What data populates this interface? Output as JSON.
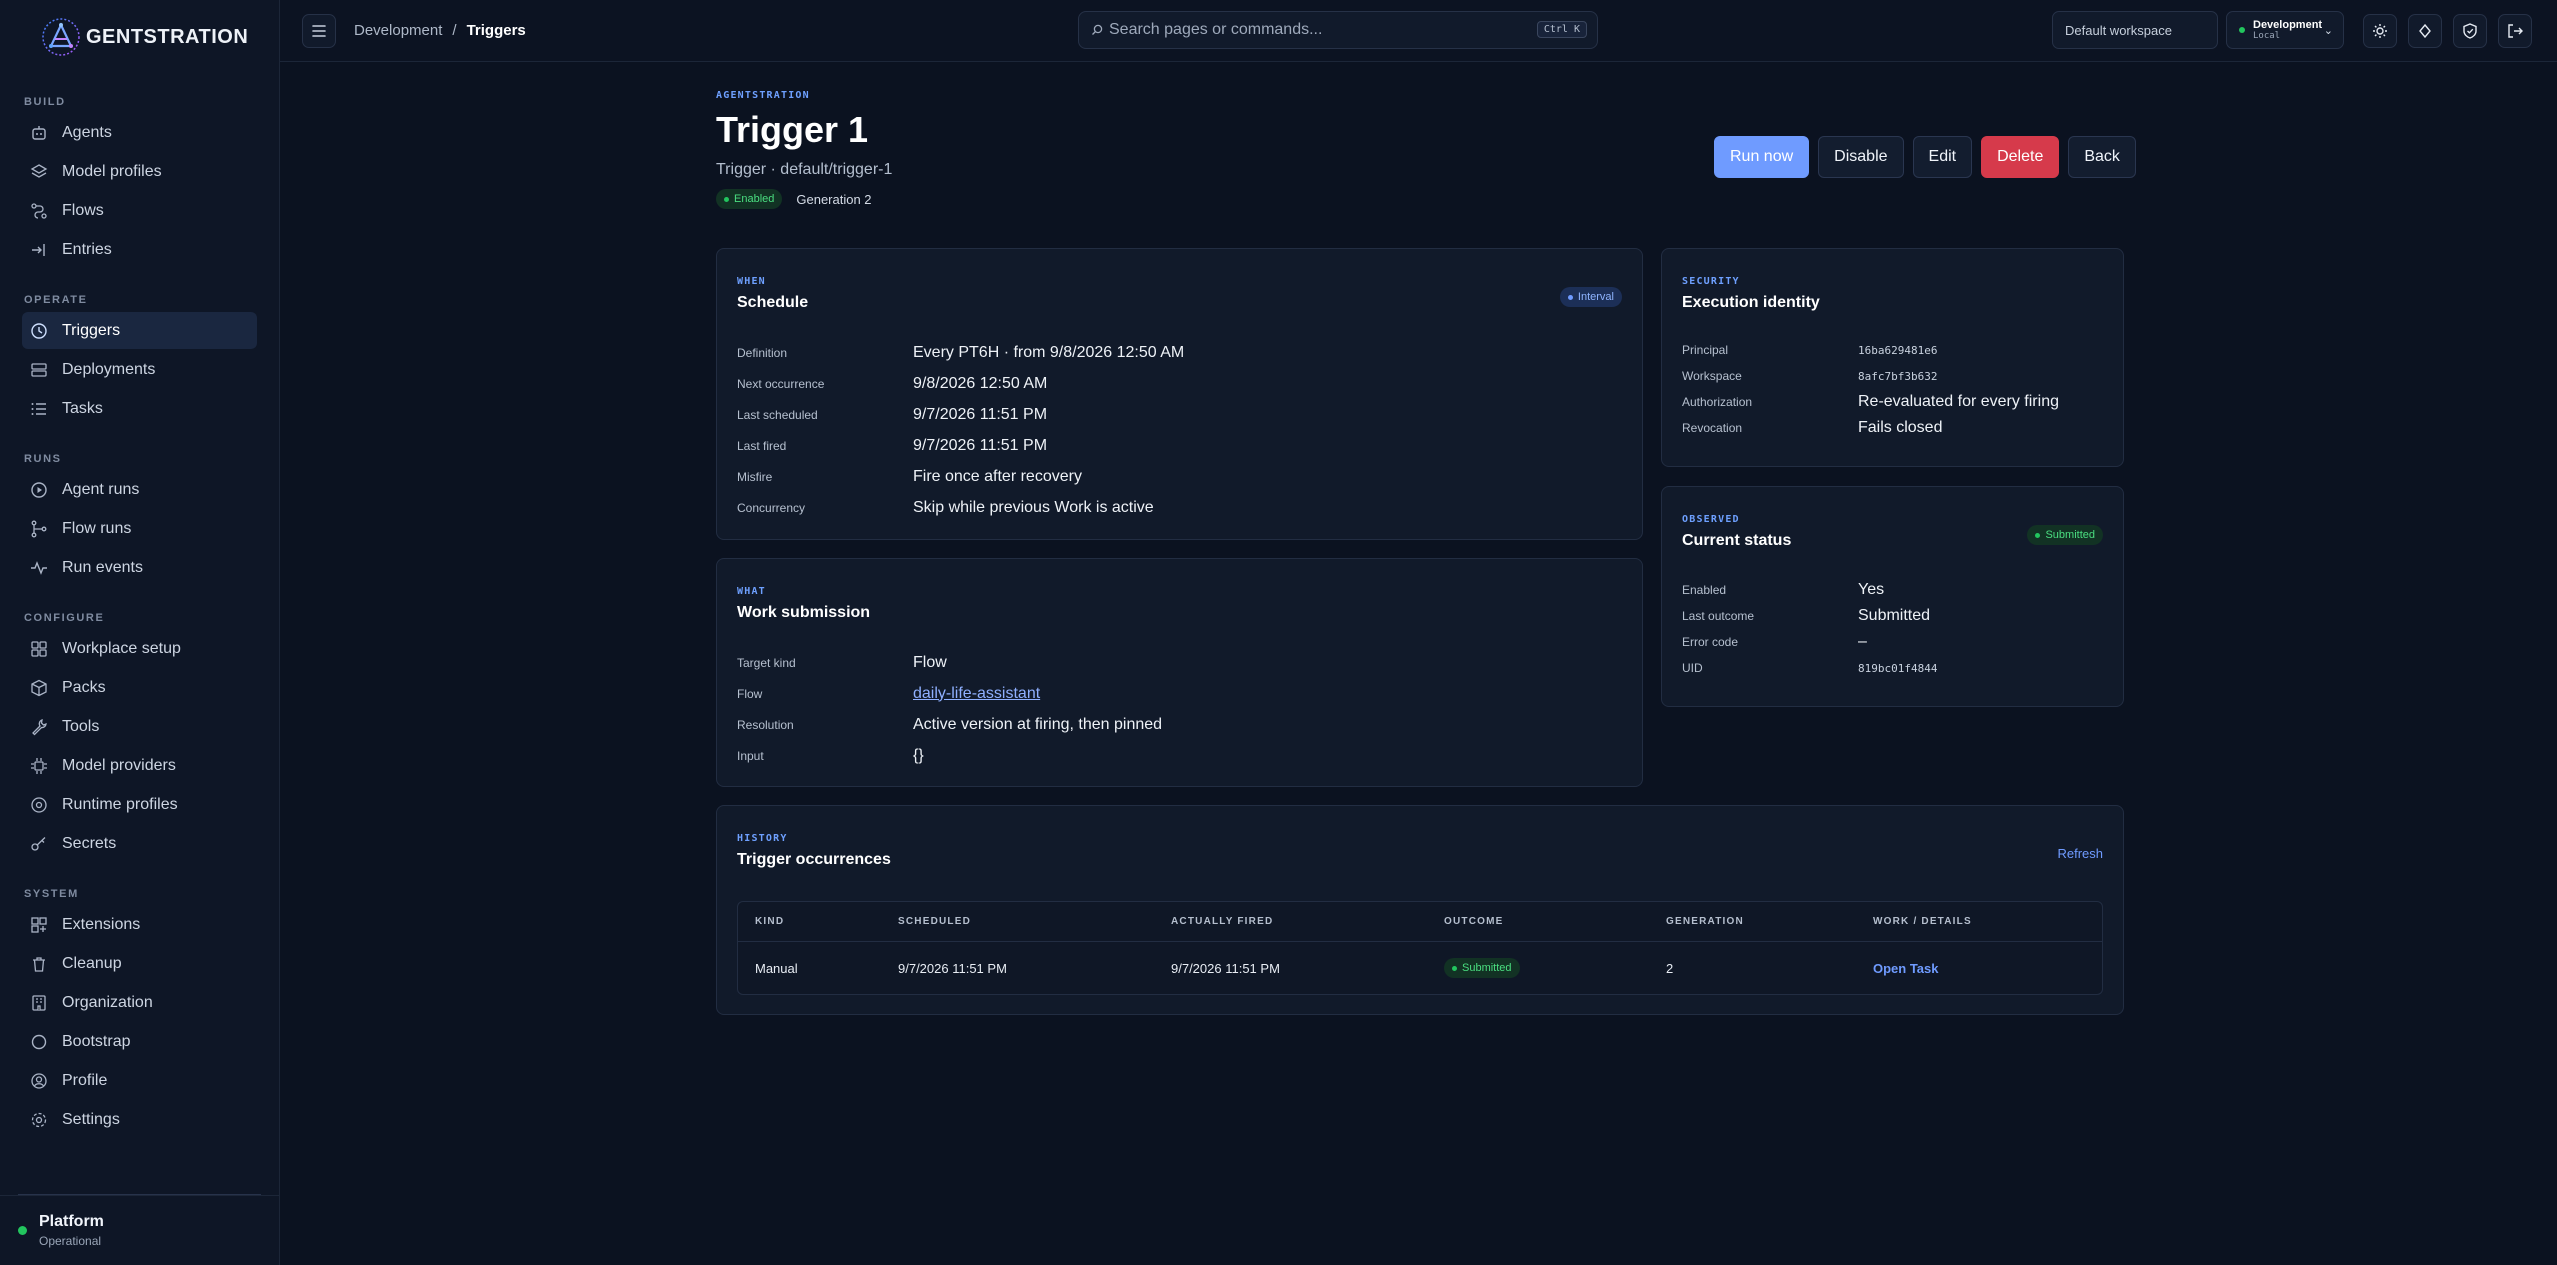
{
  "brand": {
    "name": "GENTSTRATION"
  },
  "sidebar": {
    "groups": [
      {
        "heading": "BUILD",
        "items": [
          {
            "label": "Agents",
            "icon": "agent-icon"
          },
          {
            "label": "Model profiles",
            "icon": "layers-icon"
          },
          {
            "label": "Flows",
            "icon": "flow-icon"
          },
          {
            "label": "Entries",
            "icon": "entry-icon"
          }
        ]
      },
      {
        "heading": "OPERATE",
        "items": [
          {
            "label": "Triggers",
            "icon": "clock-icon",
            "active": true
          },
          {
            "label": "Deployments",
            "icon": "deploy-icon"
          },
          {
            "label": "Tasks",
            "icon": "list-icon"
          }
        ]
      },
      {
        "heading": "RUNS",
        "items": [
          {
            "label": "Agent runs",
            "icon": "play-icon"
          },
          {
            "label": "Flow runs",
            "icon": "branch-icon"
          },
          {
            "label": "Run events",
            "icon": "activity-icon"
          }
        ]
      },
      {
        "heading": "CONFIGURE",
        "items": [
          {
            "label": "Workplace setup",
            "icon": "grid-icon"
          },
          {
            "label": "Packs",
            "icon": "box-icon"
          },
          {
            "label": "Tools",
            "icon": "wrench-icon"
          },
          {
            "label": "Model providers",
            "icon": "chip-icon"
          },
          {
            "label": "Runtime profiles",
            "icon": "server-icon"
          },
          {
            "label": "Secrets",
            "icon": "key-icon"
          }
        ]
      },
      {
        "heading": "SYSTEM",
        "items": [
          {
            "label": "Extensions",
            "icon": "puzzle-icon"
          },
          {
            "label": "Cleanup",
            "icon": "trash-icon"
          },
          {
            "label": "Organization",
            "icon": "building-icon"
          },
          {
            "label": "Bootstrap",
            "icon": "circle-icon"
          },
          {
            "label": "Profile",
            "icon": "user-icon"
          },
          {
            "label": "Settings",
            "icon": "gear-icon"
          }
        ]
      }
    ],
    "platform": {
      "name": "Platform",
      "status": "Operational"
    }
  },
  "topbar": {
    "breadcrumb": [
      "Development",
      "Triggers"
    ],
    "search_placeholder": "Search pages or commands...",
    "search_shortcut": "Ctrl K",
    "workspace": "Default workspace",
    "env_name": "Development",
    "env_sub": "Local"
  },
  "header": {
    "eyebrow": "AGENTSTRATION",
    "title": "Trigger 1",
    "subtitle": "Trigger · default/trigger-1",
    "status": "Enabled",
    "generation": "Generation 2",
    "actions": [
      "Run now",
      "Disable",
      "Edit",
      "Delete",
      "Back"
    ]
  },
  "schedule": {
    "eyebrow": "WHEN",
    "title": "Schedule",
    "badge": "Interval",
    "rows": [
      {
        "k": "Definition",
        "v": "Every PT6H · from 9/8/2026 12:50 AM"
      },
      {
        "k": "Next occurrence",
        "v": "9/8/2026 12:50 AM"
      },
      {
        "k": "Last scheduled",
        "v": "9/7/2026 11:51 PM"
      },
      {
        "k": "Last fired",
        "v": "9/7/2026 11:51 PM"
      },
      {
        "k": "Misfire",
        "v": "Fire once after recovery"
      },
      {
        "k": "Concurrency",
        "v": "Skip while previous Work is active"
      }
    ]
  },
  "work": {
    "eyebrow": "WHAT",
    "title": "Work submission",
    "rows": [
      {
        "k": "Target kind",
        "v": "Flow"
      },
      {
        "k": "Flow",
        "v": "daily-life-assistant"
      },
      {
        "k": "Resolution",
        "v": "Active version at firing, then pinned"
      },
      {
        "k": "Input",
        "v": "{}"
      }
    ]
  },
  "security": {
    "eyebrow": "SECURITY",
    "title": "Execution identity",
    "rows": [
      {
        "k": "Principal",
        "v": "16ba629481e6"
      },
      {
        "k": "Workspace",
        "v": "8afc7bf3b632"
      },
      {
        "k": "Authorization",
        "v": "Re-evaluated for every firing"
      },
      {
        "k": "Revocation",
        "v": "Fails closed"
      }
    ]
  },
  "observed": {
    "eyebrow": "OBSERVED",
    "title": "Current status",
    "badge": "Submitted",
    "rows": [
      {
        "k": "Enabled",
        "v": "Yes"
      },
      {
        "k": "Last outcome",
        "v": "Submitted"
      },
      {
        "k": "Error code",
        "v": "–"
      },
      {
        "k": "UID",
        "v": "819bc01f4844"
      }
    ]
  },
  "history": {
    "eyebrow": "HISTORY",
    "title": "Trigger occurrences",
    "refresh": "Refresh",
    "columns": [
      "KIND",
      "SCHEDULED",
      "ACTUALLY FIRED",
      "OUTCOME",
      "GENERATION",
      "WORK / DETAILS"
    ],
    "rows": [
      {
        "kind": "Manual",
        "scheduled": "9/7/2026 11:51 PM",
        "fired": "9/7/2026 11:51 PM",
        "outcome": "Submitted",
        "generation": "2",
        "details": "Open Task"
      }
    ]
  }
}
